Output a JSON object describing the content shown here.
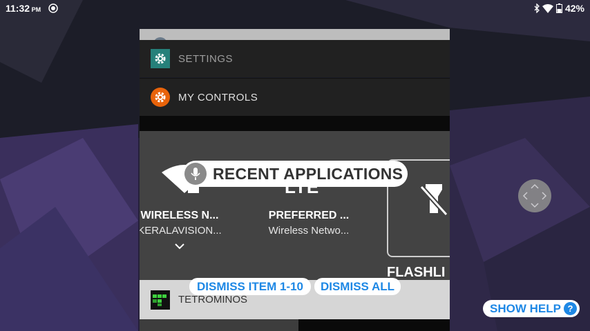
{
  "status_bar": {
    "time": "11:32",
    "ampm": "PM",
    "battery": "42%"
  },
  "cards": {
    "settings": {
      "label": "SETTINGS",
      "icon": "gear-icon",
      "color": "#26807a"
    },
    "my_controls": {
      "label": "MY CONTROLS",
      "icon": "gear-icon",
      "color": "#e8630a"
    }
  },
  "recent_overlay": {
    "label": "RECENT APPLICATIONS"
  },
  "tiles": {
    "wireless": {
      "title": "WIRELESS N...",
      "subtitle": "KERALAVISION..."
    },
    "preferred": {
      "title": "PREFERRED ...",
      "subtitle": "Wireless Netwo...",
      "icon_text": "LTE"
    },
    "flashlight": {
      "title": "FLASHLI"
    }
  },
  "tetrominos": {
    "label": "TETROMINOS"
  },
  "dismiss": {
    "item_range": "DISMISS ITEM 1-10",
    "all": "DISMISS ALL"
  },
  "help": {
    "label": "SHOW HELP",
    "q": "?"
  },
  "colors": {
    "accent": "#1e88e5"
  }
}
